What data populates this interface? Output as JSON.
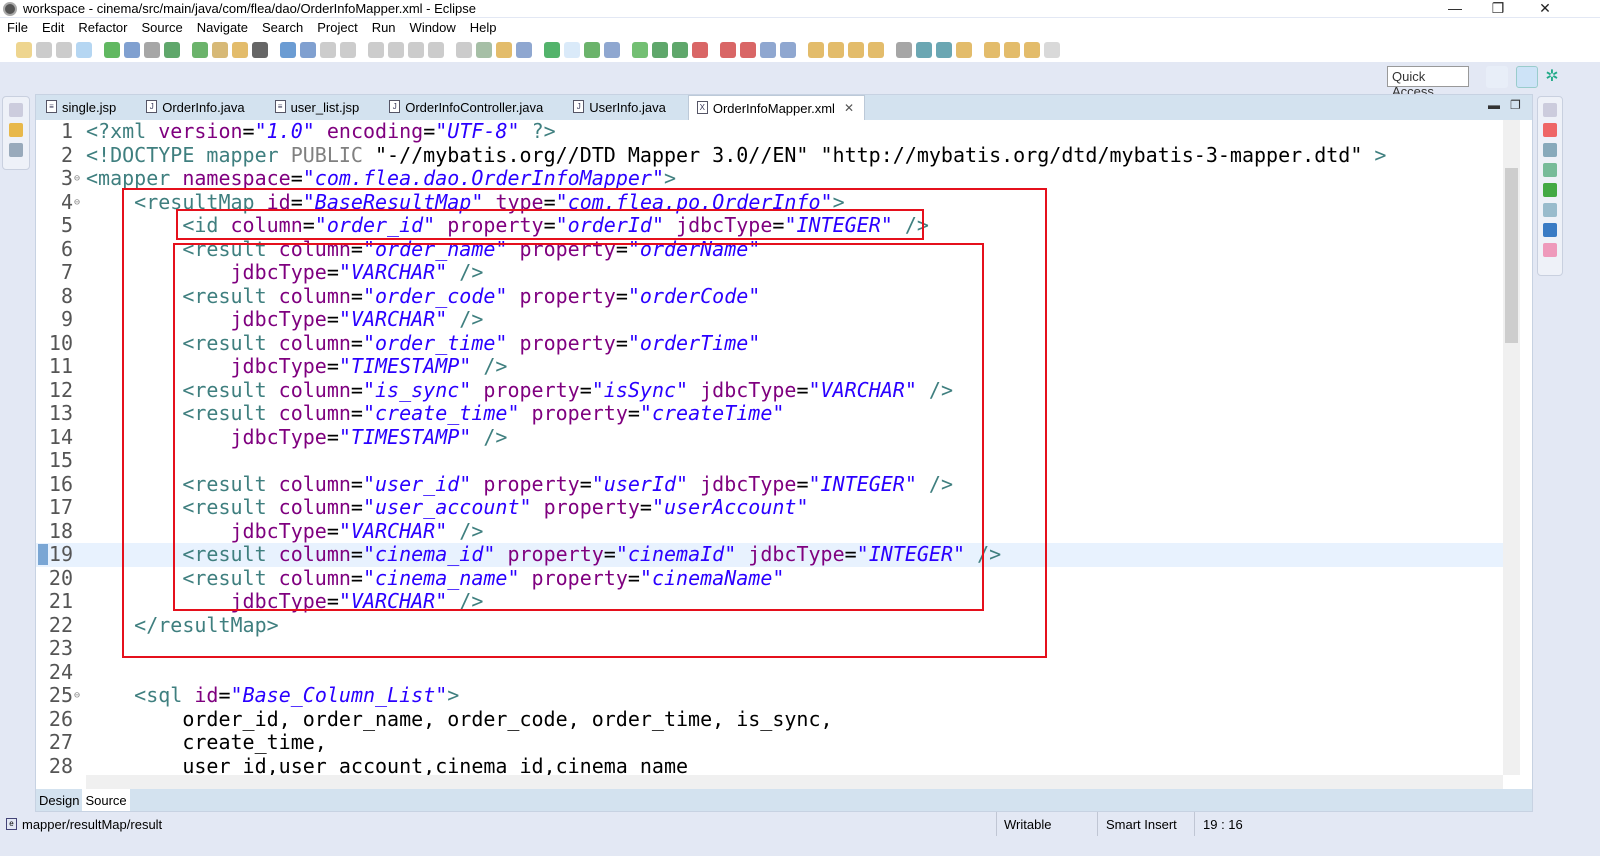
{
  "window": {
    "title": "workspace - cinema/src/main/java/com/flea/dao/OrderInfoMapper.xml - Eclipse",
    "minimize": "—",
    "restore": "❐",
    "close": "✕"
  },
  "menu": [
    "File",
    "Edit",
    "Refactor",
    "Source",
    "Navigate",
    "Search",
    "Project",
    "Run",
    "Window",
    "Help"
  ],
  "quick_access": "Quick Access",
  "tabs": [
    {
      "label": "single.jsp",
      "icon": "jsp-file-icon"
    },
    {
      "label": "OrderInfo.java",
      "icon": "java-file-icon"
    },
    {
      "label": "user_list.jsp",
      "icon": "jsp-file-icon"
    },
    {
      "label": "OrderInfoController.java",
      "icon": "java-file-icon"
    },
    {
      "label": "UserInfo.java",
      "icon": "java-file-icon"
    },
    {
      "label": "OrderInfoMapper.xml",
      "icon": "xml-file-icon",
      "active": true,
      "close": "✕"
    }
  ],
  "colors": {
    "tag": "#3f7f7f",
    "attr": "#7f007f",
    "value": "#2a00ff",
    "highlight_box": "#e5101c",
    "current_line": "#e8f2fe"
  },
  "editor": {
    "current_line": 19,
    "lines": [
      {
        "n": "1",
        "t": [
          [
            "t",
            "<?xml "
          ],
          [
            "a",
            "version"
          ],
          [
            "p",
            "="
          ],
          [
            "v",
            "\"1.0\""
          ],
          [
            "p",
            " "
          ],
          [
            "a",
            "encoding"
          ],
          [
            "p",
            "="
          ],
          [
            "v",
            "\"UTF-8\""
          ],
          [
            "t",
            " ?>"
          ]
        ]
      },
      {
        "n": "2",
        "t": [
          [
            "t",
            "<!DOCTYPE mapper "
          ],
          [
            "g",
            "PUBLIC "
          ],
          [
            "p",
            "\"-//mybatis.org//DTD Mapper 3.0//EN\" \"http://mybatis.org/dtd/mybatis-3-mapper.dtd\" "
          ],
          [
            "t",
            ">"
          ]
        ]
      },
      {
        "n": "3",
        "f": true,
        "t": [
          [
            "t",
            "<mapper "
          ],
          [
            "a",
            "namespace"
          ],
          [
            "p",
            "="
          ],
          [
            "v",
            "\"com.flea.dao.OrderInfoMapper\""
          ],
          [
            "t",
            ">"
          ]
        ]
      },
      {
        "n": "4",
        "f": true,
        "t": [
          [
            "p",
            "    "
          ],
          [
            "t",
            "<resultMap "
          ],
          [
            "a",
            "id"
          ],
          [
            "p",
            "="
          ],
          [
            "v",
            "\"BaseResultMap\""
          ],
          [
            "p",
            " "
          ],
          [
            "a",
            "type"
          ],
          [
            "p",
            "="
          ],
          [
            "v",
            "\"com.flea.po.OrderInfo\""
          ],
          [
            "t",
            ">"
          ]
        ]
      },
      {
        "n": "5",
        "t": [
          [
            "p",
            "        "
          ],
          [
            "t",
            "<id "
          ],
          [
            "a",
            "column"
          ],
          [
            "p",
            "="
          ],
          [
            "v",
            "\"order_id\""
          ],
          [
            "p",
            " "
          ],
          [
            "a",
            "property"
          ],
          [
            "p",
            "="
          ],
          [
            "v",
            "\"orderId\""
          ],
          [
            "p",
            " "
          ],
          [
            "a",
            "jdbcType"
          ],
          [
            "p",
            "="
          ],
          [
            "v",
            "\"INTEGER\""
          ],
          [
            "t",
            " />"
          ]
        ]
      },
      {
        "n": "6",
        "t": [
          [
            "p",
            "        "
          ],
          [
            "t",
            "<result "
          ],
          [
            "a",
            "column"
          ],
          [
            "p",
            "="
          ],
          [
            "v",
            "\"order_name\""
          ],
          [
            "p",
            " "
          ],
          [
            "a",
            "property"
          ],
          [
            "p",
            "="
          ],
          [
            "v",
            "\"orderName\""
          ]
        ]
      },
      {
        "n": "7",
        "t": [
          [
            "p",
            "            "
          ],
          [
            "a",
            "jdbcType"
          ],
          [
            "p",
            "="
          ],
          [
            "v",
            "\"VARCHAR\""
          ],
          [
            "t",
            " />"
          ]
        ]
      },
      {
        "n": "8",
        "t": [
          [
            "p",
            "        "
          ],
          [
            "t",
            "<result "
          ],
          [
            "a",
            "column"
          ],
          [
            "p",
            "="
          ],
          [
            "v",
            "\"order_code\""
          ],
          [
            "p",
            " "
          ],
          [
            "a",
            "property"
          ],
          [
            "p",
            "="
          ],
          [
            "v",
            "\"orderCode\""
          ]
        ]
      },
      {
        "n": "9",
        "t": [
          [
            "p",
            "            "
          ],
          [
            "a",
            "jdbcType"
          ],
          [
            "p",
            "="
          ],
          [
            "v",
            "\"VARCHAR\""
          ],
          [
            "t",
            " />"
          ]
        ]
      },
      {
        "n": "10",
        "t": [
          [
            "p",
            "        "
          ],
          [
            "t",
            "<result "
          ],
          [
            "a",
            "column"
          ],
          [
            "p",
            "="
          ],
          [
            "v",
            "\"order_time\""
          ],
          [
            "p",
            " "
          ],
          [
            "a",
            "property"
          ],
          [
            "p",
            "="
          ],
          [
            "v",
            "\"orderTime\""
          ]
        ]
      },
      {
        "n": "11",
        "t": [
          [
            "p",
            "            "
          ],
          [
            "a",
            "jdbcType"
          ],
          [
            "p",
            "="
          ],
          [
            "v",
            "\"TIMESTAMP\""
          ],
          [
            "t",
            " />"
          ]
        ]
      },
      {
        "n": "12",
        "t": [
          [
            "p",
            "        "
          ],
          [
            "t",
            "<result "
          ],
          [
            "a",
            "column"
          ],
          [
            "p",
            "="
          ],
          [
            "v",
            "\"is_sync\""
          ],
          [
            "p",
            " "
          ],
          [
            "a",
            "property"
          ],
          [
            "p",
            "="
          ],
          [
            "v",
            "\"isSync\""
          ],
          [
            "p",
            " "
          ],
          [
            "a",
            "jdbcType"
          ],
          [
            "p",
            "="
          ],
          [
            "v",
            "\"VARCHAR\""
          ],
          [
            "t",
            " />"
          ]
        ]
      },
      {
        "n": "13",
        "t": [
          [
            "p",
            "        "
          ],
          [
            "t",
            "<result "
          ],
          [
            "a",
            "column"
          ],
          [
            "p",
            "="
          ],
          [
            "v",
            "\"create_time\""
          ],
          [
            "p",
            " "
          ],
          [
            "a",
            "property"
          ],
          [
            "p",
            "="
          ],
          [
            "v",
            "\"createTime\""
          ]
        ]
      },
      {
        "n": "14",
        "t": [
          [
            "p",
            "            "
          ],
          [
            "a",
            "jdbcType"
          ],
          [
            "p",
            "="
          ],
          [
            "v",
            "\"TIMESTAMP\""
          ],
          [
            "t",
            " />"
          ]
        ]
      },
      {
        "n": "15",
        "t": []
      },
      {
        "n": "16",
        "t": [
          [
            "p",
            "        "
          ],
          [
            "t",
            "<result "
          ],
          [
            "a",
            "column"
          ],
          [
            "p",
            "="
          ],
          [
            "v",
            "\"user_id\""
          ],
          [
            "p",
            " "
          ],
          [
            "a",
            "property"
          ],
          [
            "p",
            "="
          ],
          [
            "v",
            "\"userId\""
          ],
          [
            "p",
            " "
          ],
          [
            "a",
            "jdbcType"
          ],
          [
            "p",
            "="
          ],
          [
            "v",
            "\"INTEGER\""
          ],
          [
            "t",
            " />"
          ]
        ]
      },
      {
        "n": "17",
        "t": [
          [
            "p",
            "        "
          ],
          [
            "t",
            "<result "
          ],
          [
            "a",
            "column"
          ],
          [
            "p",
            "="
          ],
          [
            "v",
            "\"user_account\""
          ],
          [
            "p",
            " "
          ],
          [
            "a",
            "property"
          ],
          [
            "p",
            "="
          ],
          [
            "v",
            "\"userAccount\""
          ]
        ]
      },
      {
        "n": "18",
        "t": [
          [
            "p",
            "            "
          ],
          [
            "a",
            "jdbcType"
          ],
          [
            "p",
            "="
          ],
          [
            "v",
            "\"VARCHAR\""
          ],
          [
            "t",
            " />"
          ]
        ]
      },
      {
        "n": "19",
        "t": [
          [
            "p",
            "        "
          ],
          [
            "t",
            "<result "
          ],
          [
            "a",
            "column"
          ],
          [
            "p",
            "="
          ],
          [
            "v",
            "\"cinema_id\""
          ],
          [
            "p",
            " "
          ],
          [
            "a",
            "property"
          ],
          [
            "p",
            "="
          ],
          [
            "v",
            "\"cinemaId\""
          ],
          [
            "p",
            " "
          ],
          [
            "a",
            "jdbcType"
          ],
          [
            "p",
            "="
          ],
          [
            "v",
            "\"INTEGER\""
          ],
          [
            "t",
            " />"
          ]
        ]
      },
      {
        "n": "20",
        "t": [
          [
            "p",
            "        "
          ],
          [
            "t",
            "<result "
          ],
          [
            "a",
            "column"
          ],
          [
            "p",
            "="
          ],
          [
            "v",
            "\"cinema_name\""
          ],
          [
            "p",
            " "
          ],
          [
            "a",
            "property"
          ],
          [
            "p",
            "="
          ],
          [
            "v",
            "\"cinemaName\""
          ]
        ]
      },
      {
        "n": "21",
        "t": [
          [
            "p",
            "            "
          ],
          [
            "a",
            "jdbcType"
          ],
          [
            "p",
            "="
          ],
          [
            "v",
            "\"VARCHAR\""
          ],
          [
            "t",
            " />"
          ]
        ]
      },
      {
        "n": "22",
        "t": [
          [
            "p",
            "    "
          ],
          [
            "t",
            "</resultMap>"
          ]
        ]
      },
      {
        "n": "23",
        "t": []
      },
      {
        "n": "24",
        "t": []
      },
      {
        "n": "25",
        "f": true,
        "t": [
          [
            "p",
            "    "
          ],
          [
            "t",
            "<sql "
          ],
          [
            "a",
            "id"
          ],
          [
            "p",
            "="
          ],
          [
            "v",
            "\"Base_Column_List\""
          ],
          [
            "t",
            ">"
          ]
        ]
      },
      {
        "n": "26",
        "t": [
          [
            "p",
            "        order_id, order_name, order_code, order_time, is_sync,"
          ]
        ]
      },
      {
        "n": "27",
        "t": [
          [
            "p",
            "        create_time,"
          ]
        ]
      },
      {
        "n": "28",
        "t": [
          [
            "p",
            "        user_id,user_account,cinema_id,cinema_name"
          ]
        ]
      }
    ]
  },
  "bottom_tabs": [
    "Design",
    "Source"
  ],
  "status": {
    "path": "mapper/resultMap/result",
    "writable": "Writable",
    "insert_mode": "Smart Insert",
    "position": "19 : 16"
  }
}
